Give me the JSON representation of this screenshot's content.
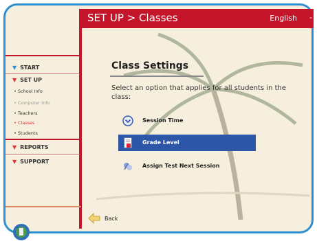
{
  "header": {
    "breadcrumb": "SET UP > Classes",
    "language": "English",
    "lang_dash": "-"
  },
  "sidebar": {
    "sections": [
      {
        "label": "START",
        "arrow": "▼"
      },
      {
        "label": "SET UP",
        "arrow": "▼"
      },
      {
        "label": "REPORTS",
        "arrow": "▼"
      },
      {
        "label": "SUPPORT",
        "arrow": "▼"
      }
    ],
    "setup_items": [
      {
        "label": "• School Info"
      },
      {
        "label": "• Computer Info"
      },
      {
        "label": "• Teachers"
      },
      {
        "label": "• Classes"
      },
      {
        "label": "• Students"
      }
    ]
  },
  "main": {
    "title": "Class Settings",
    "description": "Select an option that applies for all students in the class:",
    "options": [
      {
        "label": "Session Time",
        "icon": "chevron-circle-icon"
      },
      {
        "label": "Grade Level",
        "icon": "document-icon"
      },
      {
        "label": "Assign Test Next Session",
        "icon": "assign-icon"
      }
    ],
    "selected_option": "Grade Level",
    "back_label": "Back"
  },
  "colors": {
    "header_red": "#c4152b",
    "frame_blue": "#2e8fd0",
    "selected_blue": "#2d55a8"
  }
}
